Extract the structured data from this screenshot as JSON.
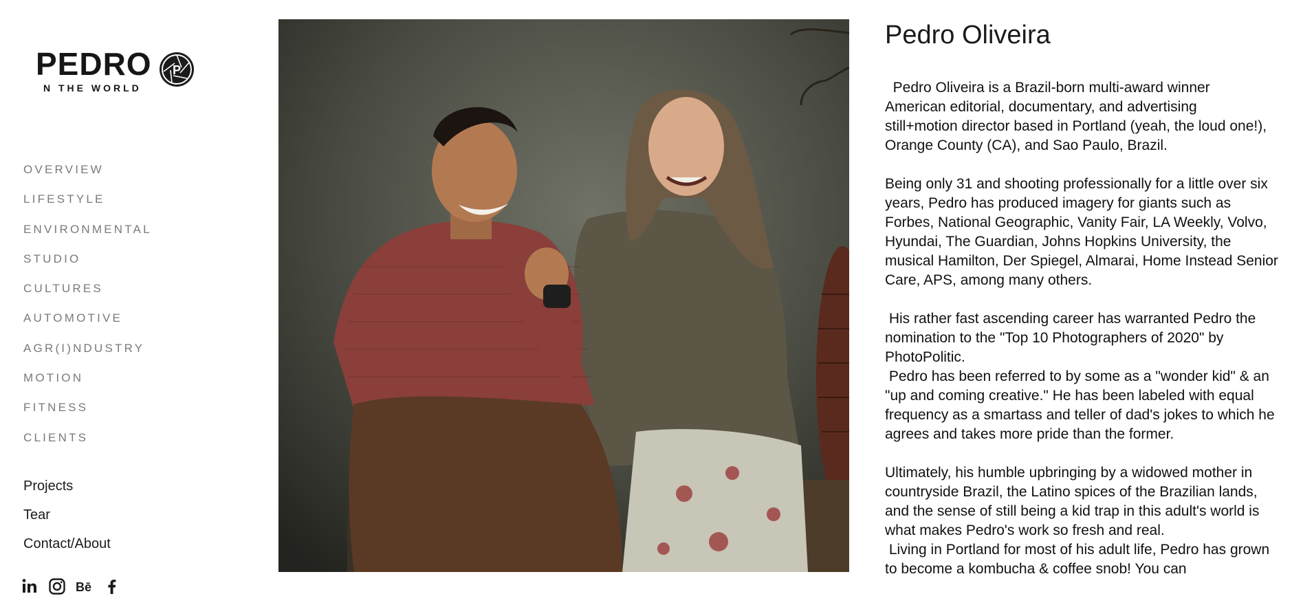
{
  "brand": {
    "wordmark": "PEDRO",
    "subline": "N THE WORLD",
    "badge_letter": "P"
  },
  "nav": {
    "categories": [
      "OVERVIEW",
      "LIFESTYLE",
      "ENVIRONMENTAL",
      "STUDIO",
      "CULTURES",
      "AUTOMOTIVE",
      "AGR(I)NDUSTRY",
      "MOTION",
      "FITNESS",
      "CLIENTS"
    ],
    "pages": [
      "Projects",
      "Tear",
      "Contact/About"
    ]
  },
  "social": {
    "icons": [
      "linkedin-icon",
      "instagram-icon",
      "behance-icon",
      "facebook-icon"
    ],
    "labels": [
      "in",
      "",
      "Bē",
      "f"
    ]
  },
  "about": {
    "title": "Pedro Oliveira",
    "paragraphs": [
      "  Pedro Oliveira is a Brazil-born multi-award winner American editorial, documentary, and advertising still+motion director based in Portland (yeah, the loud one!),  Orange County (CA), and Sao Paulo, Brazil.",
      "Being only 31 and shooting professionally for a little over six years, Pedro has produced imagery for giants such as Forbes, National Geographic, Vanity Fair, LA Weekly, Volvo, Hyundai, The Guardian, Johns Hopkins University, the musical Hamilton, Der Spiegel, Almarai, Home Instead Senior Care, APS, among many others.",
      " His rather fast ascending career has warranted Pedro the nomination to the \"Top 10 Photographers of 2020\" by PhotoPolitic.\n Pedro has been referred to by some as a \"wonder kid\" & an \"up and coming creative.\" He has been labeled with equal frequency as a smartass and teller of dad's jokes to which he\nagrees and takes more pride than the former.",
      "Ultimately, his humble upbringing by a widowed mother in countryside Brazil, the Latino spices of the Brazilian lands,  and the sense of still being a kid trap in this adult's world is what makes Pedro's work so fresh and real.\n Living in Portland for most of his adult life, Pedro has grown to become a kombucha & coffee snob! You can"
    ]
  }
}
